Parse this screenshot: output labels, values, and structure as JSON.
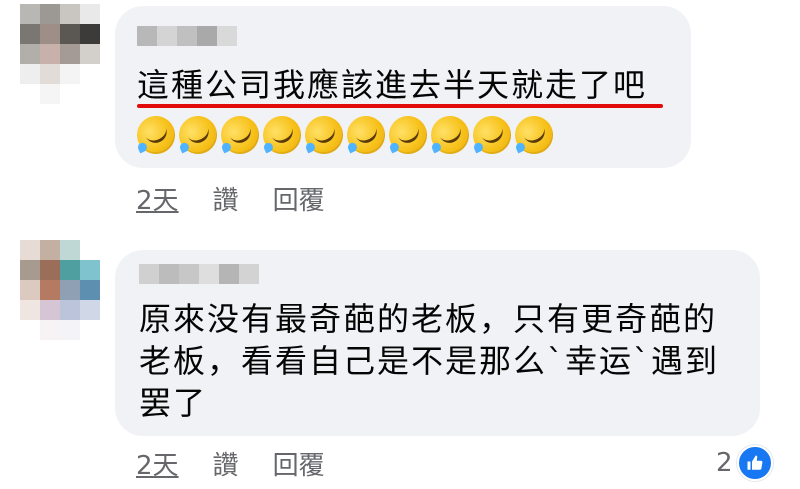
{
  "comments": [
    {
      "text": "這種公司我應該進去半天就走了吧",
      "emoji_name": "rolling-on-floor-laughing",
      "emoji_count": 10,
      "time": "2天",
      "like_label": "讚",
      "reply_label": "回覆"
    },
    {
      "text": "原來没有最奇葩的老板，只有更奇葩的老板，看看自己是不是那么`幸运`遇到罢了",
      "time": "2天",
      "like_label": "讚",
      "reply_label": "回覆",
      "reaction_count": "2",
      "reaction_icon": "thumbs-up-icon"
    }
  ],
  "colors": {
    "bubble": "#f0f2f5",
    "meta_text": "#65676b",
    "underline": "#e10b0b",
    "like_blue": "#1877f2"
  }
}
